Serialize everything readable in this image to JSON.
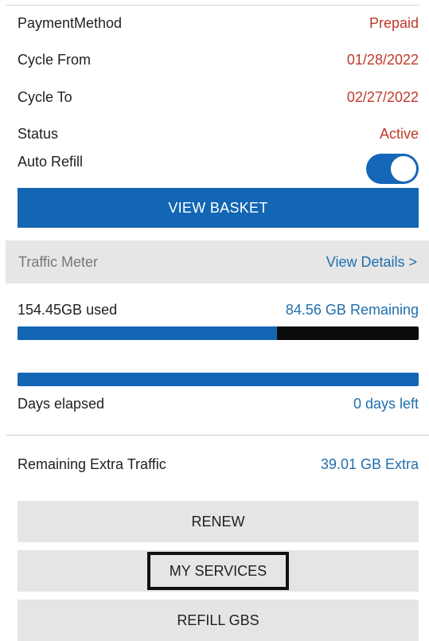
{
  "details": {
    "payment_method": {
      "label": "PaymentMethod",
      "value": "Prepaid"
    },
    "cycle_from": {
      "label": "Cycle From",
      "value": "01/28/2022"
    },
    "cycle_to": {
      "label": "Cycle To",
      "value": "02/27/2022"
    },
    "status": {
      "label": "Status",
      "value": "Active"
    },
    "auto_refill": {
      "label": "Auto Refill",
      "enabled": true
    }
  },
  "view_basket_label": "VIEW BASKET",
  "traffic_meter": {
    "title": "Traffic Meter",
    "view_details_label": "View Details >",
    "used_label": "154.45GB used",
    "remaining_label": "84.56 GB Remaining",
    "usage_fraction": 0.646
  },
  "days": {
    "elapsed_label": "Days elapsed",
    "left_label": "0 days left",
    "elapsed_fraction": 1.0
  },
  "extra_traffic": {
    "label": "Remaining Extra Traffic",
    "value": "39.01 GB Extra"
  },
  "actions": {
    "renew": "RENEW",
    "my_services": "MY SERVICES",
    "refill_gbs": "REFILL GBS"
  },
  "colors": {
    "accent_blue": "#1266b4",
    "value_red": "#c0392b",
    "link_blue": "#1f6fae"
  }
}
